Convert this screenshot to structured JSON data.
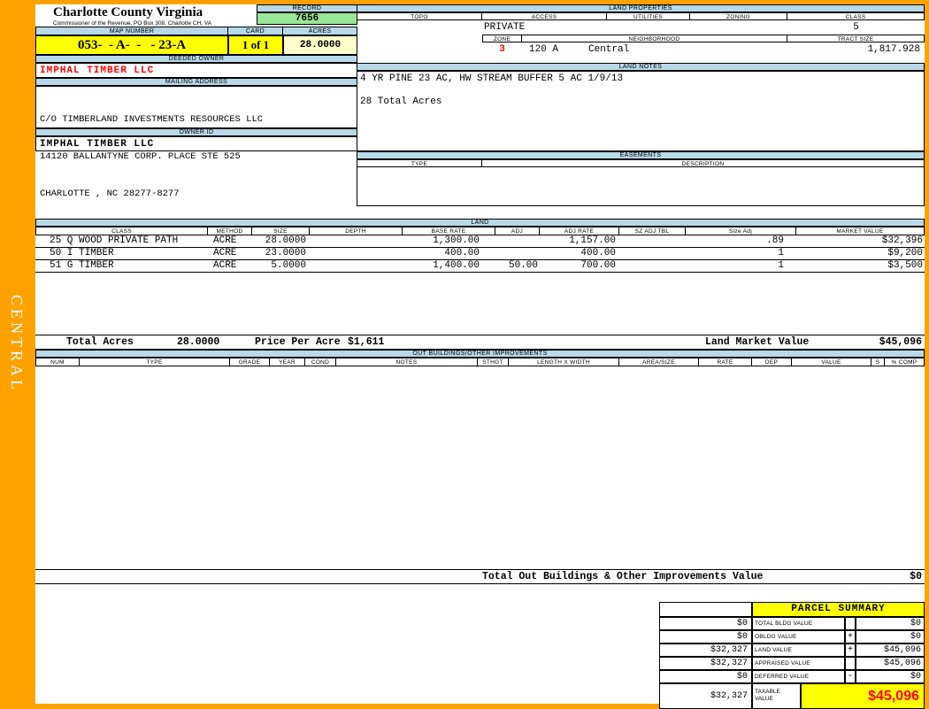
{
  "county": {
    "title": "Charlotte County Virginia",
    "subtitle": "Commissioner of the Revenue, PO Box 308, Charlotte CH, VA"
  },
  "sidebar": {
    "district_label": "CENTRAL"
  },
  "record": {
    "label": "RECORD",
    "value": "7656"
  },
  "map_number": {
    "label": "MAP NUMBER",
    "value": "053-  - A-  -   - 23-A"
  },
  "card_field": {
    "label": "CARD",
    "value": "1 of 1"
  },
  "acres_field": {
    "label": "ACRES",
    "value": "28.0000"
  },
  "deeded_owner": {
    "label": "DEEDED OWNER",
    "value": "IMPHAL TIMBER LLC"
  },
  "mailing_address": {
    "label": "MAILING ADDRESS",
    "line1": "C/O TIMBERLAND INVESTMENTS RESOURCES LLC",
    "line2": "14120 BALLANTYNE CORP. PLACE STE 525",
    "line3": "CHARLOTTE , NC 28277-8277"
  },
  "owner_id": {
    "label": "OWNER ID",
    "value": "IMPHAL TIMBER LLC"
  },
  "land_properties": {
    "label": "LAND PROPERTIES",
    "topo_label": "TOPO",
    "access_label": "ACCESS",
    "access_value": "PRIVATE",
    "utilities_label": "UTILITIES",
    "zoning_label": "ZONING",
    "class_label": "CLASS",
    "class_value": "5",
    "zone_label": "ZONE",
    "zone_value": "3",
    "neighborhood_label": "NEIGHBORHOOD",
    "neighborhood_code": "120 A",
    "neighborhood_name": "Central",
    "tract_size_label": "TRACT SIZE",
    "tract_size_value": "1,817.928"
  },
  "land_notes": {
    "label": "LAND NOTES",
    "line1": "4 YR PINE 23 AC, HW STREAM BUFFER 5 AC 1/9/13",
    "line2": "28 Total Acres"
  },
  "easements": {
    "label": "EASEMENTS",
    "type_label": "TYPE",
    "description_label": "DESCRIPTION"
  },
  "land": {
    "label": "LAND",
    "headers": [
      "CLASS",
      "METHOD",
      "SIZE",
      "DEPTH",
      "BASE RATE",
      "ADJ",
      "ADJ RATE",
      "SZ ADJ TBL",
      "Size Adj",
      "MARKET VALUE"
    ],
    "rows": [
      [
        "25 Q WOOD PRIVATE PATH",
        "ACRE",
        "28.0000",
        "",
        "1,300.00",
        "",
        "1,157.00",
        "",
        ".89",
        "$32,396"
      ],
      [
        "50 I TIMBER",
        "ACRE",
        "23.0000",
        "",
        "400.00",
        "",
        "400.00",
        "",
        "1",
        "$9,200"
      ],
      [
        "51 G TIMBER",
        "ACRE",
        "5.0000",
        "",
        "1,400.00",
        "50.00",
        "700.00",
        "",
        "1",
        "$3,500"
      ]
    ],
    "totals": {
      "total_acres_label": "Total Acres",
      "total_acres_value": "28.0000",
      "price_per_acre_label": "Price Per Acre",
      "price_per_acre_value": "$1,611",
      "market_value_label": "Land Market Value",
      "market_value_value": "$45,096"
    }
  },
  "out_buildings": {
    "label": "OUT BUILDINGS/OTHER IMPROVEMENTS",
    "headers": [
      "NUM",
      "TYPE",
      "GRADE",
      "YEAR",
      "COND",
      "NOTES",
      "STHGT",
      "LENGTH X WIDTH",
      "AREA/SIZE",
      "RATE",
      "DEP",
      "VALUE",
      "S",
      "% COMP"
    ],
    "total_label": "Total Out Buildings & Other Improvements Value",
    "total_value": "$0"
  },
  "parcel_summary": {
    "title": "PARCEL SUMMARY",
    "rows": [
      {
        "prior": "$0",
        "label": "TOTAL BLDG VALUE",
        "op": "",
        "value": "$0"
      },
      {
        "prior": "$0",
        "label": "OBLDG VALUE",
        "op": "+",
        "value": "$0"
      },
      {
        "prior": "$32,327",
        "label": "LAND VALUE",
        "op": "+",
        "value": "$45,096"
      },
      {
        "prior": "$32,327",
        "label": "APPRAISED VALUE",
        "op": "",
        "value": "$45,096"
      },
      {
        "prior": "$0",
        "label": "DEFERRED VALUE",
        "op": "-",
        "value": "$0"
      },
      {
        "prior": "$32,327",
        "label_line1": "TAXABLE",
        "label_line2": "VALUE",
        "value": "$45,096"
      }
    ]
  },
  "colors": {
    "frame_orange": "#FFA200",
    "section_header_blue": "#B7D9E8",
    "record_green": "#98E698",
    "highlight_yellow": "#FFFF00",
    "acres_cream": "#FFFFCC",
    "alert_red": "#FF0000"
  }
}
